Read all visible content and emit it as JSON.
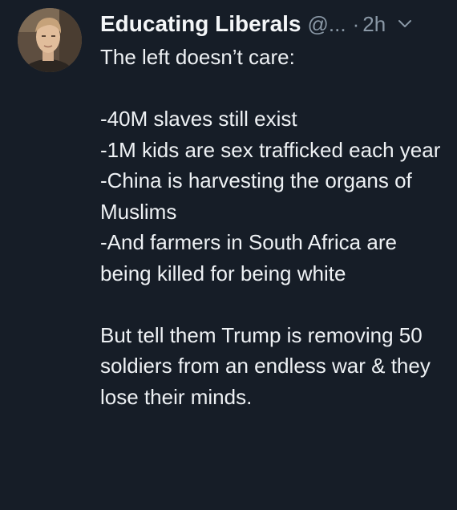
{
  "tweet": {
    "display_name": "Educating Liberals",
    "handle": "@...",
    "separator": "·",
    "time": "2h",
    "avatar_icon": "profile-photo",
    "menu_icon": "chevron-down-icon",
    "intro": "The left doesn’t care:",
    "items": [
      "-40M slaves still exist",
      "-1M kids are sex trafficked each year",
      "-China is harvesting the organs of Muslims",
      "-And farmers in South Africa are being killed for being white"
    ],
    "closing": "But tell them Trump is removing 50 soldiers from an endless war & they lose their minds."
  },
  "colors": {
    "background": "#161d27",
    "text": "#eef1f4",
    "muted": "#8a98a6"
  }
}
